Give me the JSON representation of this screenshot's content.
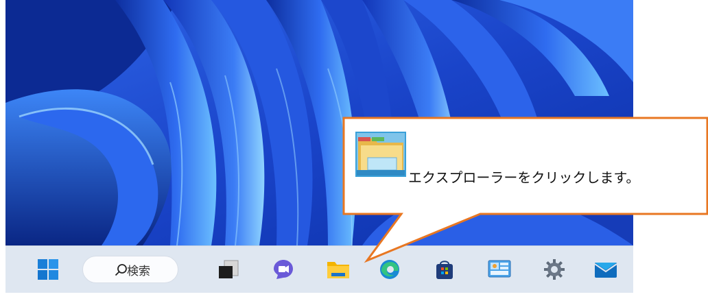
{
  "taskbar": {
    "items": [
      {
        "name": "start-button",
        "icon": "windows-logo-icon"
      },
      {
        "name": "search",
        "icon": "search-icon",
        "label": "検索"
      },
      {
        "name": "task-view-button",
        "icon": "task-view-icon"
      },
      {
        "name": "chat-button",
        "icon": "teams-chat-icon"
      },
      {
        "name": "file-explorer-button",
        "icon": "folder-icon"
      },
      {
        "name": "edge-button",
        "icon": "edge-browser-icon"
      },
      {
        "name": "store-button",
        "icon": "store-bag-icon"
      },
      {
        "name": "control-panel-button",
        "icon": "control-panel-icon"
      },
      {
        "name": "settings-button",
        "icon": "gear-icon"
      },
      {
        "name": "mail-button",
        "icon": "mail-envelope-icon"
      }
    ]
  },
  "callout": {
    "text": "エクスプローラーをクリックします。",
    "icon": "file-explorer-icon",
    "border_color": "#e87722"
  },
  "colors": {
    "wallpaper_dark": "#0a2a8c",
    "wallpaper_light": "#4aa3ff",
    "taskbar_bg": "#dfe7f1"
  }
}
